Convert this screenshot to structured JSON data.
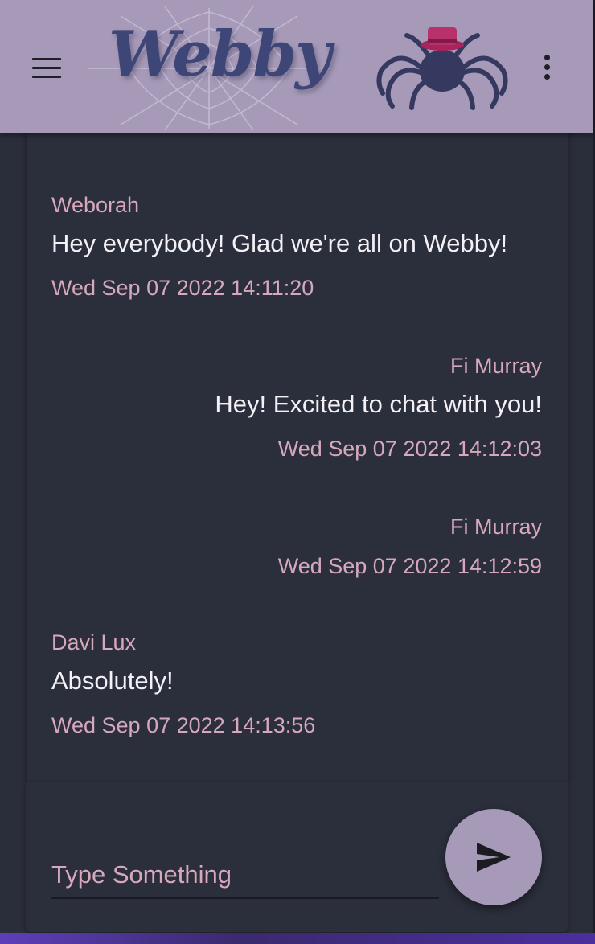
{
  "app": {
    "title": "Webby",
    "header_color": "#a79ab9",
    "accent_color": "#d7a8bd",
    "background_color": "#2a2d3a"
  },
  "header": {
    "menu_icon": "hamburger-menu-icon",
    "more_icon": "kebab-menu-icon",
    "mascot_icon": "spider-with-top-hat-icon"
  },
  "messages": [
    {
      "author": "Weborah",
      "text": "Hey everybody! Glad we're all on Webby!",
      "timestamp": "Wed Sep 07 2022 14:11:20",
      "side": "left"
    },
    {
      "author": "Fi Murray",
      "text": "Hey! Excited to chat with you!",
      "timestamp": "Wed Sep 07 2022 14:12:03",
      "side": "right"
    },
    {
      "author": "Fi Murray",
      "text": "",
      "timestamp": "Wed Sep 07 2022 14:12:59",
      "side": "right"
    },
    {
      "author": "Davi Lux",
      "text": "Absolutely!",
      "timestamp": "Wed Sep 07 2022 14:13:56",
      "side": "left"
    }
  ],
  "composer": {
    "placeholder": "Type Something",
    "send_icon": "send-icon"
  }
}
